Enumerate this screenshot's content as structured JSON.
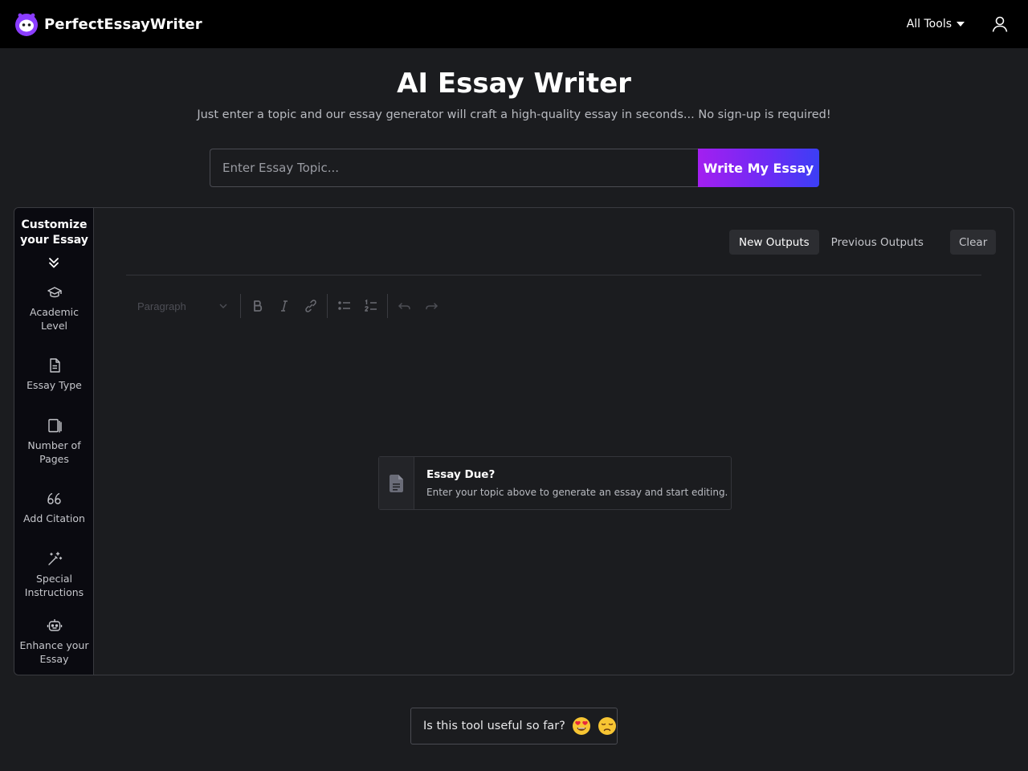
{
  "header": {
    "brand": "PerfectEssayWriter",
    "all_tools_label": "All Tools"
  },
  "hero": {
    "title": "AI Essay Writer",
    "subtitle": "Just enter a topic and our essay generator will craft a high-quality essay in seconds... No sign-up is required!",
    "input_placeholder": "Enter Essay Topic...",
    "input_value": "",
    "submit_label": "Write My Essay"
  },
  "sidebar": {
    "title": "Customize your Essay",
    "items": [
      {
        "label": "Academic Level",
        "icon": "graduation-cap-icon"
      },
      {
        "label": "Essay Type",
        "icon": "document-icon"
      },
      {
        "label": "Number of Pages",
        "icon": "pages-icon"
      },
      {
        "label": "Add Citation",
        "icon": "quote-icon"
      },
      {
        "label": "Special Instructions",
        "icon": "magic-wand-icon"
      },
      {
        "label": "Enhance your Essay",
        "icon": "robot-icon"
      }
    ]
  },
  "editor": {
    "tabs": [
      "New Outputs",
      "Previous Outputs"
    ],
    "active_tab": "New Outputs",
    "clear_label": "Clear",
    "block_format": "Paragraph",
    "notice_title": "Essay Due?",
    "notice_text": "Enter your topic above to generate an essay and start editing."
  },
  "feedback": {
    "question": "Is this tool useful so far?"
  },
  "colors": {
    "background": "#1b1c1f",
    "topbar": "#000000",
    "sidebar": "#0a0a10",
    "accent_start": "#a31ff0",
    "accent_end": "#3b3ff5"
  }
}
